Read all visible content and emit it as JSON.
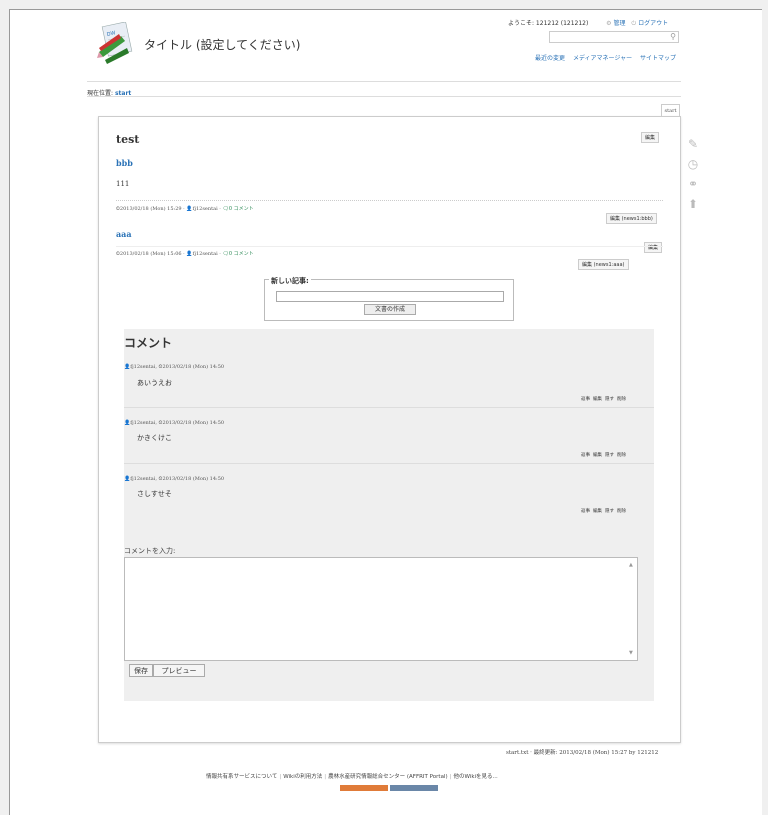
{
  "header": {
    "site_title": "タイトル (設定してください)",
    "welcome": "ようこそ: 121212 (121212)",
    "admin": "管理",
    "logout": "ログアウト",
    "links": [
      "最近の変更",
      "メディアマネージャー",
      "サイトマップ"
    ]
  },
  "breadcrumb": {
    "label": "現在位置:",
    "page": "start"
  },
  "page_tab": "start",
  "article": {
    "title": "test",
    "edit": "編集",
    "entries": [
      {
        "title": "bbb",
        "body": "111",
        "date": "2013/02/18 (Mon) 15:29",
        "author": "fj12sentai",
        "comments": "0 コメント",
        "edit": "編集 (news1:bbb)"
      },
      {
        "title": "aaa",
        "date": "2013/02/18 (Mon) 15:06",
        "author": "fj12sentai",
        "comments": "0 コメント",
        "edit_top": "編集",
        "edit": "編集 (news1:aaa)"
      }
    ],
    "new_article": {
      "legend": "新しい記事:",
      "button": "文書の作成"
    }
  },
  "comments": {
    "title": "コメント",
    "items": [
      {
        "author": "fj12sentai",
        "date": "2013/02/18 (Mon) 14:50",
        "text": "あいうえお"
      },
      {
        "author": "fj12sentai",
        "date": "2013/02/18 (Mon) 14:50",
        "text": "かきくけこ"
      },
      {
        "author": "fj12sentai",
        "date": "2013/02/18 (Mon) 14:50",
        "text": "さしすせそ"
      }
    ],
    "actions": [
      "返事",
      "編集",
      "隠す",
      "削除"
    ],
    "input_label": "コメントを入力:",
    "save": "保存",
    "preview": "プレビュー"
  },
  "docinfo": "start.txt · 最終更新: 2013/02/18 (Mon) 15:27 by 121212",
  "footer": {
    "links": [
      "情報共有系サービスについて",
      "Wikiの利用方法",
      "農林水産研究情報総合センター (AFFRIT Portal)",
      "他のWikiを見る..."
    ]
  },
  "colors": {
    "link": "#2b73b7",
    "comment_link": "#2e8b57",
    "comment_bg": "#efefef"
  },
  "icons": [
    "gear-icon",
    "power-icon",
    "search-icon",
    "clock-icon",
    "user-icon",
    "comment-icon",
    "pencil-icon",
    "history-icon",
    "link-icon",
    "arrow-up-icon"
  ]
}
